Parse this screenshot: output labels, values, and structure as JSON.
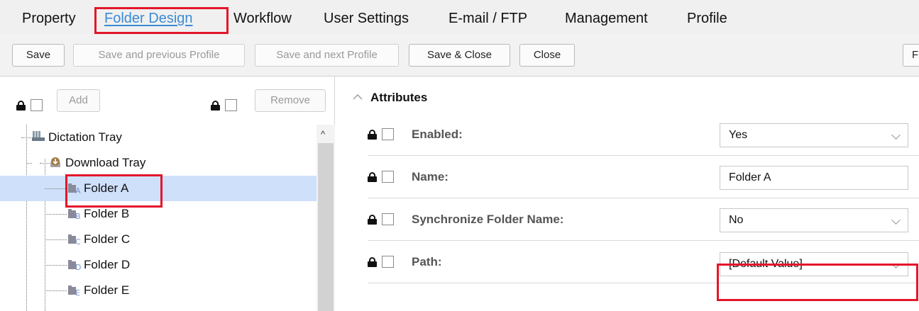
{
  "menu": {
    "items": [
      {
        "label": "Property",
        "active": false
      },
      {
        "label": "Folder Design",
        "active": true
      },
      {
        "label": "Workflow",
        "active": false
      },
      {
        "label": "User Settings",
        "active": false
      },
      {
        "label": "E-mail / FTP",
        "active": false
      },
      {
        "label": "Management",
        "active": false
      },
      {
        "label": "Profile",
        "active": false
      }
    ]
  },
  "toolbar": {
    "save": "Save",
    "save_prev": "Save and previous Profile",
    "save_next": "Save and next Profile",
    "save_close": "Save & Close",
    "close": "Close",
    "cut_button": "F"
  },
  "left_panel": {
    "add_label": "Add",
    "remove_label": "Remove",
    "tree": [
      {
        "label": "Dictation Tray",
        "level": 0,
        "icon": "tray-icon",
        "expanded": true,
        "selected": false
      },
      {
        "label": "Download Tray",
        "level": 1,
        "icon": "download-tray-icon",
        "expanded": true,
        "selected": false
      },
      {
        "label": "Folder A",
        "level": 2,
        "icon": "folder-icon",
        "letter": "A",
        "selected": true
      },
      {
        "label": "Folder B",
        "level": 2,
        "icon": "folder-icon",
        "letter": "B",
        "selected": false
      },
      {
        "label": "Folder C",
        "level": 2,
        "icon": "folder-icon",
        "letter": "C",
        "selected": false
      },
      {
        "label": "Folder D",
        "level": 2,
        "icon": "folder-icon",
        "letter": "D",
        "selected": false
      },
      {
        "label": "Folder E",
        "level": 2,
        "icon": "folder-icon",
        "letter": "E",
        "selected": false
      }
    ]
  },
  "attributes": {
    "title": "Attributes",
    "rows": [
      {
        "label": "Enabled:",
        "value": "Yes",
        "type": "select"
      },
      {
        "label": "Name:",
        "value": "Folder A",
        "type": "text"
      },
      {
        "label": "Synchronize Folder Name:",
        "value": "No",
        "type": "select"
      },
      {
        "label": "Path:",
        "value": "[Default Value]",
        "type": "select"
      }
    ]
  },
  "colors": {
    "highlight": "#e4162a",
    "active_tab": "#3a8bd6",
    "selected_row": "#cfe0fb"
  }
}
